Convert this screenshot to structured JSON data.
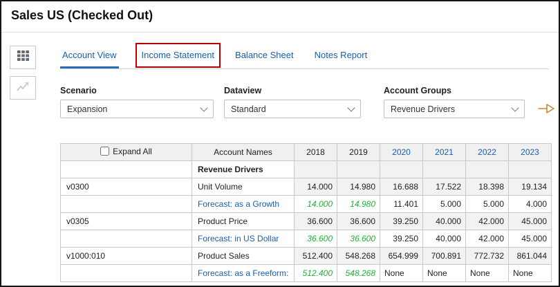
{
  "window": {
    "title": "Sales US (Checked Out)"
  },
  "sidebar": {
    "buttons": [
      {
        "name": "grid-view",
        "icon": "grid-icon"
      },
      {
        "name": "chart-view",
        "icon": "chart-icon"
      }
    ]
  },
  "tabs": [
    {
      "label": "Account View",
      "active": true
    },
    {
      "label": "Income Statement",
      "active": false,
      "annotated": true
    },
    {
      "label": "Balance Sheet",
      "active": false
    },
    {
      "label": "Notes Report",
      "active": false
    }
  ],
  "filters": [
    {
      "label": "Scenario",
      "value": "Expansion"
    },
    {
      "label": "Dataview",
      "value": "Standard"
    },
    {
      "label": "Account Groups",
      "value": "Revenue Drivers"
    }
  ],
  "table": {
    "header": {
      "expand_all": "Expand All",
      "account_names": "Account Names",
      "years": [
        {
          "label": "2018",
          "link": false
        },
        {
          "label": "2019",
          "link": false
        },
        {
          "label": "2020",
          "link": true
        },
        {
          "label": "2021",
          "link": true
        },
        {
          "label": "2022",
          "link": true
        },
        {
          "label": "2023",
          "link": true
        }
      ]
    },
    "rows": [
      {
        "code": "",
        "name": "Revenue Drivers",
        "style": "group",
        "values": [
          "",
          "",
          "",
          "",
          "",
          ""
        ],
        "green_cols": []
      },
      {
        "code": "v0300",
        "name": "Unit Volume",
        "style": "account",
        "values": [
          "14.000",
          "14.980",
          "16.688",
          "17.522",
          "18.398",
          "19.134"
        ],
        "green_cols": []
      },
      {
        "code": "",
        "name": "Forecast: as a Growth",
        "style": "forecast",
        "values": [
          "14.000",
          "14.980",
          "11.401",
          "5.000",
          "5.000",
          "4.000"
        ],
        "green_cols": [
          0,
          1
        ]
      },
      {
        "code": "v0305",
        "name": "Product Price",
        "style": "account",
        "values": [
          "36.600",
          "36.600",
          "39.250",
          "40.000",
          "42.000",
          "45.000"
        ],
        "green_cols": []
      },
      {
        "code": "",
        "name": "Forecast: in US Dollar",
        "style": "forecast",
        "values": [
          "36.600",
          "36.600",
          "39.250",
          "40.000",
          "42.000",
          "45.000"
        ],
        "green_cols": [
          0,
          1
        ]
      },
      {
        "code": "v1000:010",
        "name": "Product Sales",
        "style": "account",
        "values": [
          "512.400",
          "548.268",
          "654.999",
          "700.891",
          "772.732",
          "861.044"
        ],
        "green_cols": []
      },
      {
        "code": "",
        "name": "Forecast: as a Freeform:",
        "style": "forecast",
        "values": [
          "512.400",
          "548.268",
          "None",
          "None",
          "None",
          "None"
        ],
        "green_cols": [
          0,
          1
        ]
      }
    ]
  },
  "colors": {
    "tab_active_blue": "#1a5dab",
    "link_blue": "#1a5dab",
    "annotation_red": "#b40000",
    "forecast_green": "#1fb135",
    "arrow_orange": "#c9883a"
  }
}
